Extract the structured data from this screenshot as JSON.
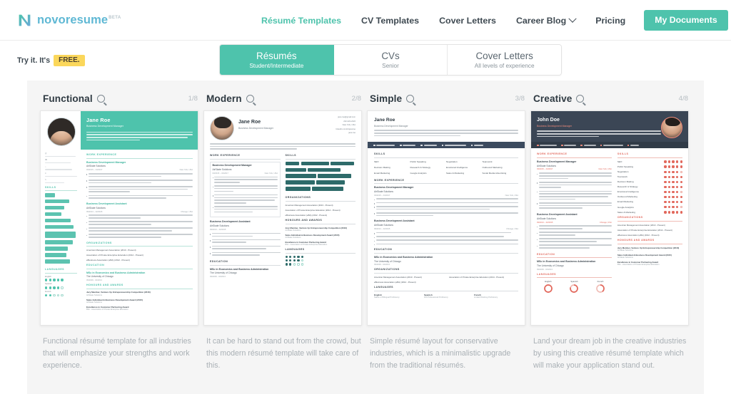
{
  "brand": {
    "name": "novoresume",
    "beta": "BETA",
    "accent": "#4ec3ac",
    "logo_color": "#5fb8d4"
  },
  "header": {
    "nav": [
      {
        "label": "Résumé Templates",
        "active": true
      },
      {
        "label": "CV Templates",
        "active": false
      },
      {
        "label": "Cover Letters",
        "active": false
      },
      {
        "label": "Career Blog",
        "active": false,
        "has_caret": true
      },
      {
        "label": "Pricing",
        "active": false
      }
    ],
    "my_documents_button": "My Documents",
    "account_caret": "chevron-down"
  },
  "subheader": {
    "try_it_prefix": "Try it. It's",
    "free_badge": "FREE.",
    "free_badge_color": "#fbd75b",
    "tabs": [
      {
        "title": "Résumés",
        "subtitle": "Student/Intermediate",
        "active": true
      },
      {
        "title": "CVs",
        "subtitle": "Senior",
        "active": false
      },
      {
        "title": "Cover Letters",
        "subtitle": "All levels of experience",
        "active": false
      }
    ]
  },
  "gallery": {
    "cards": [
      {
        "title": "Functional",
        "counter": "1/8",
        "description": "Functional résumé template for all industries that will emphasize your strengths and work experience."
      },
      {
        "title": "Modern",
        "counter": "2/8",
        "description": "It can be hard to stand out from the crowd, but this modern résumé template will take care of this."
      },
      {
        "title": "Simple",
        "counter": "3/8",
        "description": "Simple résumé layout for conservative industries, which is a minimalistic upgrade from the traditional résumés."
      },
      {
        "title": "Creative",
        "counter": "4/8",
        "description": "Land your dream job in the creative industries by using this creative résumé template which will make your application stand out."
      }
    ]
  },
  "resume_preview": {
    "person_female": {
      "name": "Jane Roe",
      "role": "Business Development Manager",
      "summary": "Professional Business Developer with more than four years of experience in the business development processes. Involved in product training, management, and development of new business opportunities.",
      "email": "jane.roe@gmail.com",
      "phone": "222-222-2222",
      "location": "New York, USA",
      "linkedin": "linkedin.com/in/janeroe",
      "skype": "jane.roe"
    },
    "person_male": {
      "name": "John Doe",
      "role": "Business Development Manager",
      "summary": "Professional Business Developer with more than four years of experience in the business development processes. Involved in product training, management, and development of new business opportunities.",
      "email": "john.doe@gmail.com",
      "phone": "222-222-2222",
      "location": "New York, USA",
      "linkedin": "linkedin.com/in/john.doe",
      "skype": "john.doe"
    },
    "sections": {
      "work_experience": "WORK EXPERIENCE",
      "skills": "SKILLS",
      "organizations": "ORGANIZATIONS",
      "education": "EDUCATION",
      "honours": "HONOURS AND AWARDS",
      "languages": "LANGUAGES"
    },
    "jobs": [
      {
        "title": "Business Development Manager",
        "company": "AirSkate Solutions",
        "dates": "03/2015 – 04/2017",
        "place": "New York, USA",
        "bullets": [
          "Successfully managed 52 - 5 million budget projects and successfully achieved the project scheduled goals.",
          "Developed and implemented new marketing and sales plans and defined the strategy for the next 3 years.",
          "Reviewed constantly the customer feedback and then suggested ways to improve the processes and customer service levels which increased the satisfaction rate from 81% to 95%.",
          "Ensured that new clients will grow into a loyal customer base in a periodic niche market by implementing a new loyalty program."
        ]
      },
      {
        "title": "Business Development Assistant",
        "company": "AirSkate Solutions",
        "dates": "09/2013 – 02/2015",
        "place": "Chicago, USA",
        "bullets": [
          "Increased the customer satisfaction rate by 15% by improving the customer service.",
          "Planned, supervised, and coordinated daily activity of 5 junior business analysts.",
          "Improved the communication with the Marketing department to better understand the competitive position.",
          "Directed the creation and implementation of a Business Continuity Plan, and the management of audit programs."
        ]
      }
    ],
    "skills": [
      "SEO",
      "Public Speaking",
      "Negotiation",
      "Teamwork",
      "Decision Making",
      "Research & Strategy",
      "Emotional Intelligence",
      "Outbound Marketing",
      "Email Marketing",
      "Google Analytics",
      "Sales & Marketing",
      "Social Media Advertising"
    ],
    "organizations": [
      "American Management Association (2013 - Present)",
      "Association of Private Enterprise Education (2014 - Present)",
      "eBusiness Association (eBA) (2012 - Present)"
    ],
    "education": {
      "degree": "MSc in Economics and Business Administration",
      "school": "The University of Chicago",
      "dates": "09/2009 - 04/2013"
    },
    "honours": [
      {
        "title": "Jury Member, Venture Up Entrepreneurship Competition (2016)",
        "meta": "AirSkate Solutions"
      },
      {
        "title": "Sales Individual & Business Development Award (2015)",
        "meta": "AirSkate Solutions"
      },
      {
        "title": "Excellence in Customer Partnering Award",
        "meta": "BSc - Association of Private Enterprise Education"
      }
    ],
    "languages": [
      {
        "name": "English",
        "level": "Native or Bilingual Proficiency",
        "dots": 5
      },
      {
        "name": "Spanish",
        "level": "Full Professional Proficiency",
        "dots": 4
      },
      {
        "name": "French",
        "level": "Limited Working Proficiency",
        "dots": 2
      }
    ],
    "skill_ratings": [
      {
        "name": "SEO",
        "dots": 5
      },
      {
        "name": "Public Speaking",
        "dots": 5
      },
      {
        "name": "Negotiation",
        "dots": 4
      },
      {
        "name": "Teamwork",
        "dots": 5
      },
      {
        "name": "Decision Making",
        "dots": 5
      },
      {
        "name": "Research & Strategy",
        "dots": 5
      },
      {
        "name": "Emotional Intelligence",
        "dots": 4
      },
      {
        "name": "Outbound Marketing",
        "dots": 5
      },
      {
        "name": "Email Marketing",
        "dots": 5
      },
      {
        "name": "Google Analytics",
        "dots": 4
      },
      {
        "name": "Sales & Marketing",
        "dots": 5
      }
    ]
  }
}
